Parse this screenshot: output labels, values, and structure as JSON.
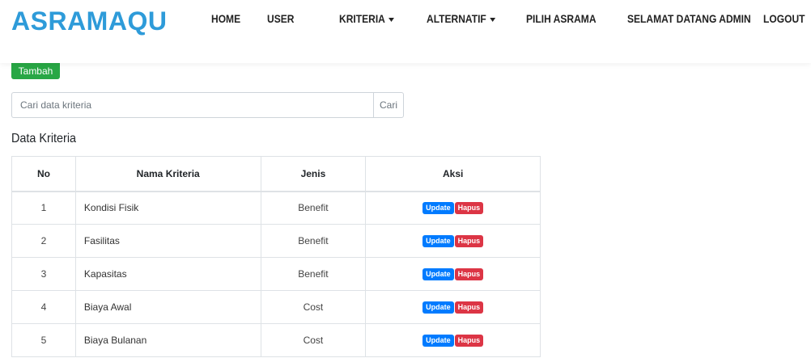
{
  "navbar": {
    "brand": "ASRAMAQU",
    "items": [
      {
        "label": "HOME",
        "dropdown": false
      },
      {
        "label": "USER",
        "dropdown": false
      },
      {
        "label": "KRITERIA",
        "dropdown": true
      },
      {
        "label": "ALTERNATIF",
        "dropdown": true
      },
      {
        "label": "PILIH ASRAMA",
        "dropdown": false
      },
      {
        "label": "SELAMAT DATANG ADMIN",
        "dropdown": false
      },
      {
        "label": "LOGOUT",
        "dropdown": false
      }
    ]
  },
  "main": {
    "add_button": "Tambah",
    "search": {
      "placeholder": "Cari data kriteria",
      "value": "",
      "button": "Cari"
    },
    "section_title": "Data Kriteria",
    "table": {
      "headers": [
        "No",
        "Nama Kriteria",
        "Jenis",
        "Aksi"
      ],
      "rows": [
        {
          "no": "1",
          "nama": "Kondisi Fisik",
          "jenis": "Benefit",
          "update": "Update",
          "hapus": "Hapus"
        },
        {
          "no": "2",
          "nama": "Fasilitas",
          "jenis": "Benefit",
          "update": "Update",
          "hapus": "Hapus"
        },
        {
          "no": "3",
          "nama": "Kapasitas",
          "jenis": "Benefit",
          "update": "Update",
          "hapus": "Hapus"
        },
        {
          "no": "4",
          "nama": "Biaya Awal",
          "jenis": "Cost",
          "update": "Update",
          "hapus": "Hapus"
        },
        {
          "no": "5",
          "nama": "Biaya Bulanan",
          "jenis": "Cost",
          "update": "Update",
          "hapus": "Hapus"
        }
      ]
    }
  },
  "colors": {
    "brand": "#2e9bd9",
    "add_button": "#28a745",
    "update_badge": "#007bff",
    "hapus_badge": "#dc3545"
  }
}
